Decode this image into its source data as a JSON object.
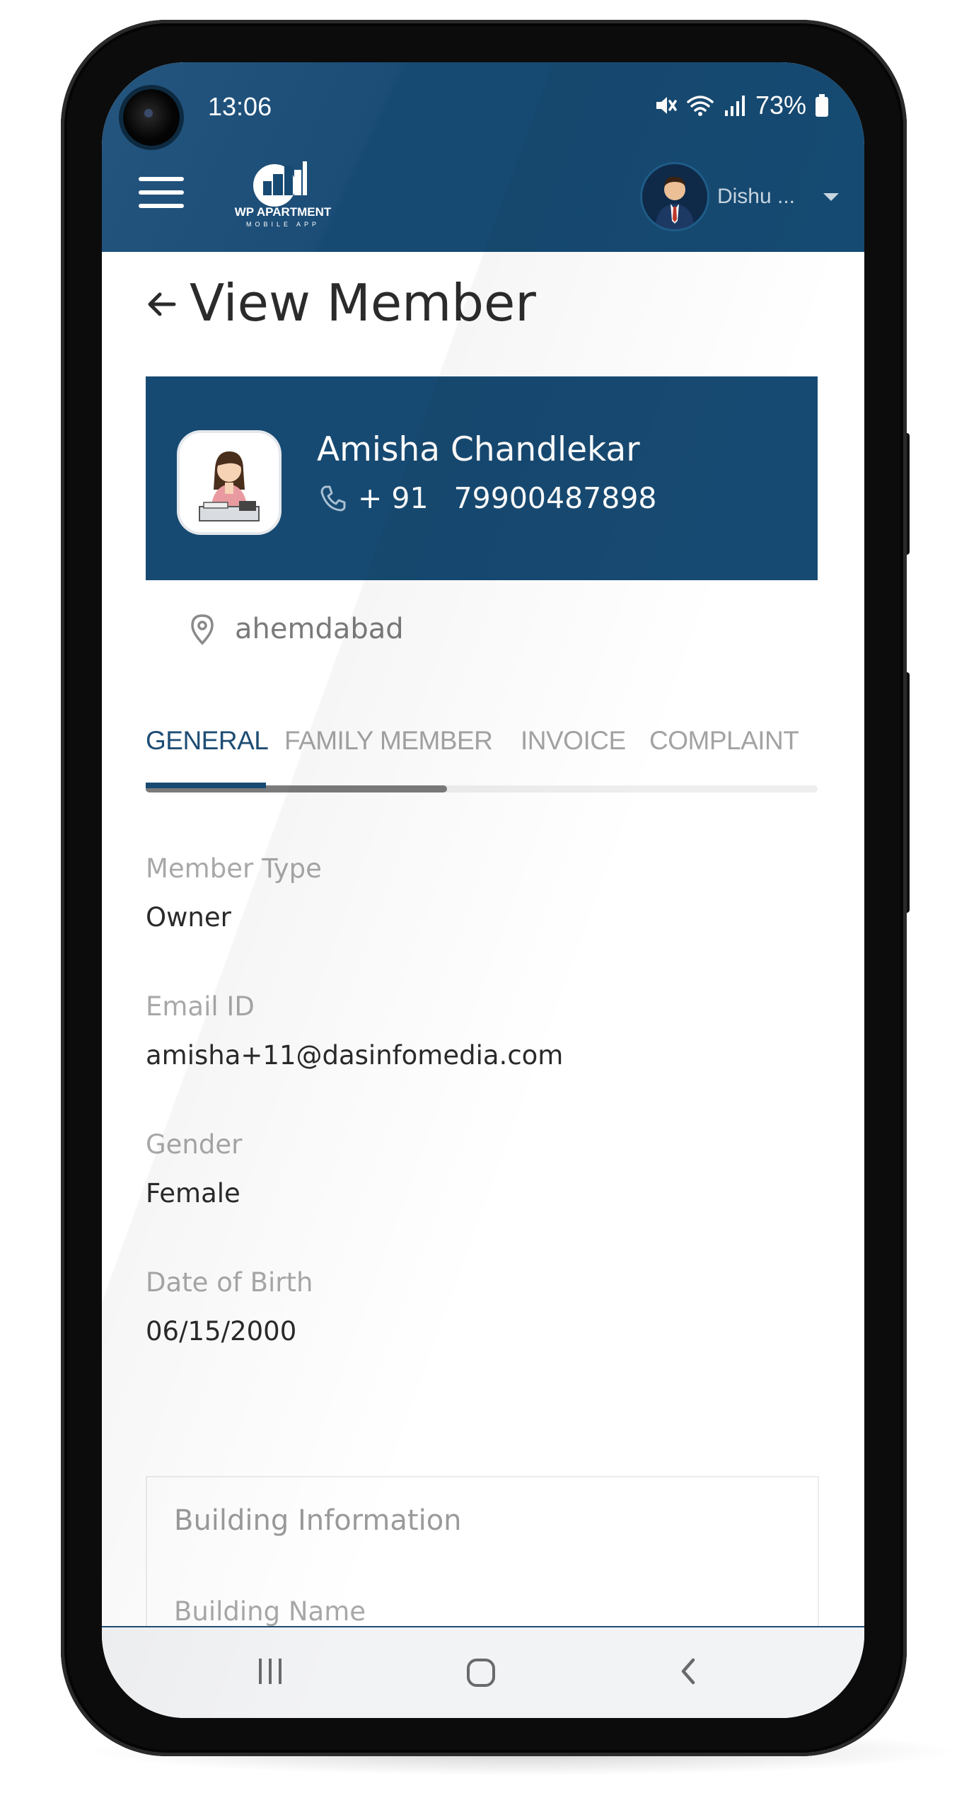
{
  "status_bar": {
    "time": "13:06",
    "battery": "73%"
  },
  "header": {
    "menu_icon": "hamburger-menu-icon",
    "logo": {
      "line1": "WP APARTMENT",
      "line2": "MOBILE APP"
    },
    "user": {
      "name": "Dishu ...",
      "dropdown_icon": "caret-down-icon"
    },
    "bg_color": "#174a72"
  },
  "page": {
    "title": "View Member",
    "back_icon": "arrow-left-icon"
  },
  "profile": {
    "name": "Amisha Chandlekar",
    "phone_code": "+ 91",
    "phone_number": "79900487898",
    "location": "ahemdabad"
  },
  "tabs": [
    {
      "label": "GENERAL",
      "active": true
    },
    {
      "label": "FAMILY MEMBER",
      "active": false
    },
    {
      "label": "INVOICE",
      "active": false
    },
    {
      "label": "COMPLAINT",
      "active": false
    }
  ],
  "general": {
    "member_type": {
      "label": "Member Type",
      "value": "Owner"
    },
    "email": {
      "label": "Email ID",
      "value": "amisha+11@dasinfomedia.com"
    },
    "gender": {
      "label": "Gender",
      "value": "Female"
    },
    "dob": {
      "label": "Date of Birth",
      "value": "06/15/2000"
    }
  },
  "building": {
    "section_title": "Building Information",
    "building_name_label": "Building Name"
  },
  "nav_bar": {
    "recents_icon": "recents-icon",
    "home_icon": "home-icon",
    "back_icon": "back-chevron-icon"
  }
}
